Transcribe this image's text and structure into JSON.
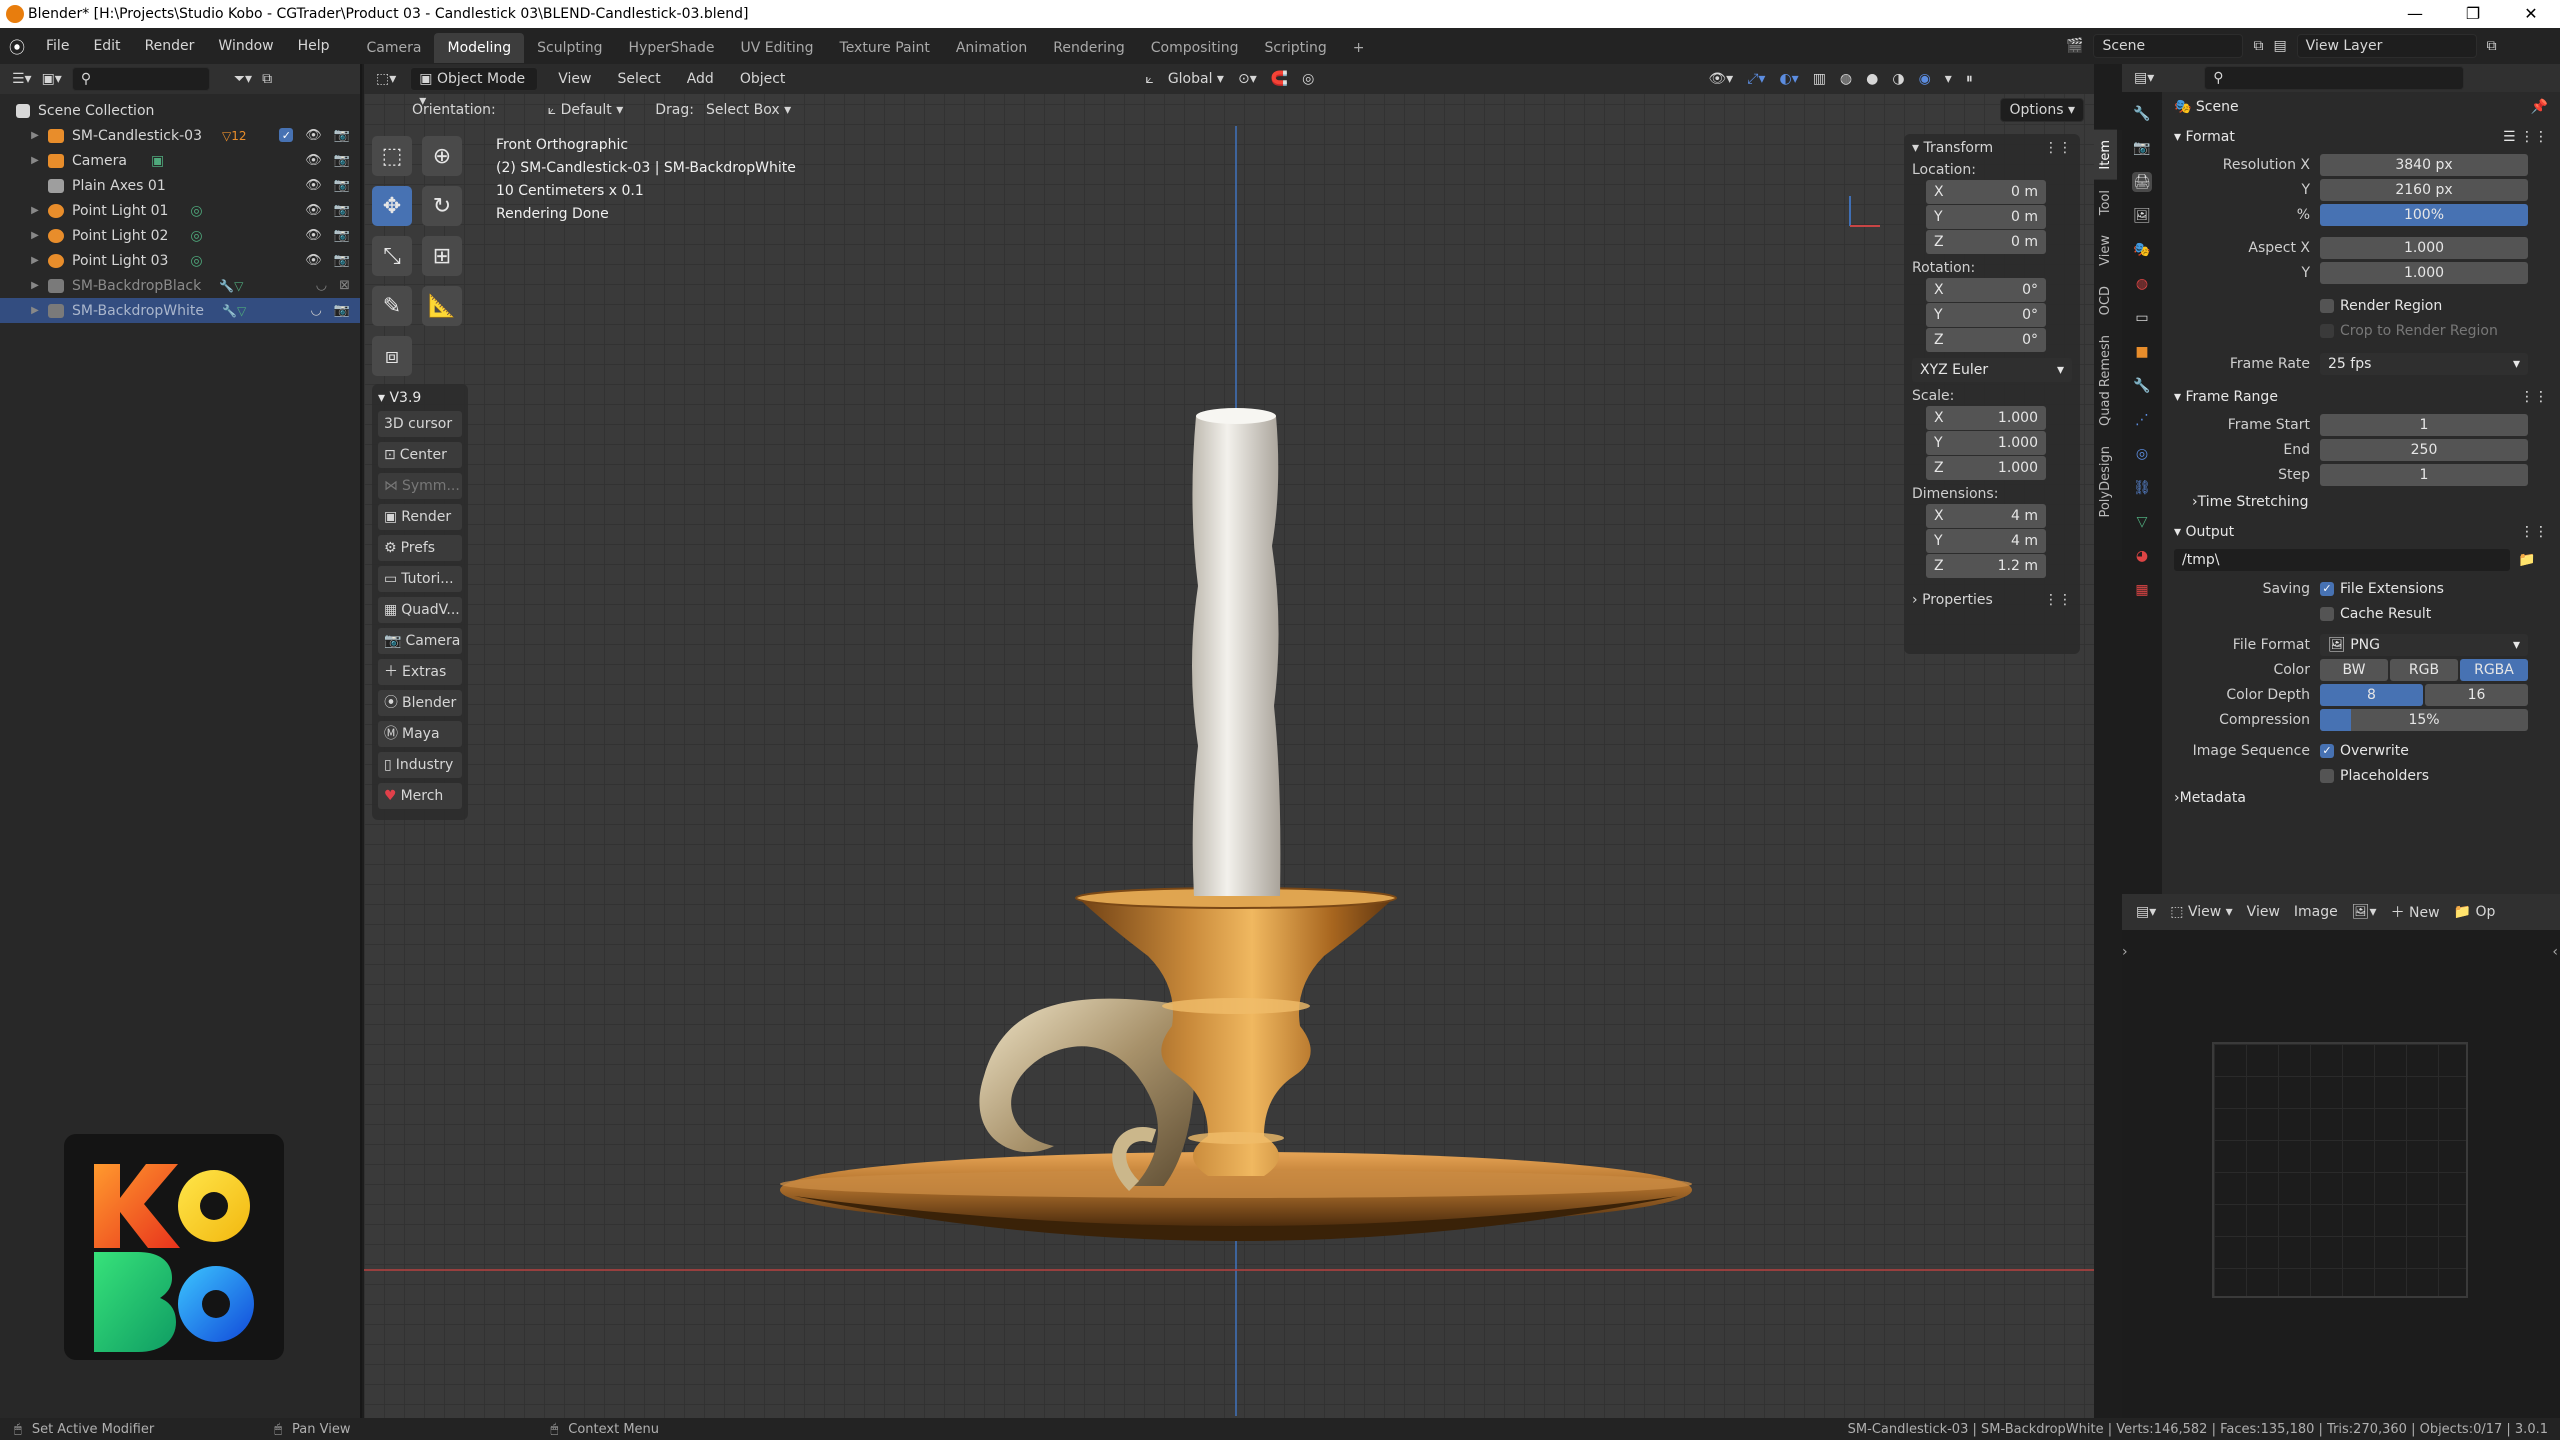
{
  "titlebar": {
    "title": "Blender* [H:\\Projects\\Studio Kobo - CGTrader\\Product 03 - Candlestick 03\\BLEND-Candlestick-03.blend]"
  },
  "menu": [
    "File",
    "Edit",
    "Render",
    "Window",
    "Help"
  ],
  "workspaces": [
    "Camera",
    "Modeling",
    "Sculpting",
    "HyperShade",
    "UV Editing",
    "Texture Paint",
    "Animation",
    "Rendering",
    "Compositing",
    "Scripting"
  ],
  "workspace_add": "+",
  "topright": {
    "scene": "Scene",
    "view_layer": "View Layer"
  },
  "outliner": {
    "root": "Scene Collection",
    "items": [
      {
        "name": "SM-Candlestick-03",
        "badge": "12",
        "color": "#e88d2b"
      },
      {
        "name": "Camera",
        "color": "#e88d2b"
      },
      {
        "name": "Plain Axes 01",
        "color": "#9e9e9e"
      },
      {
        "name": "Point Light 01",
        "color": "#e88d2b"
      },
      {
        "name": "Point Light 02",
        "color": "#e88d2b"
      },
      {
        "name": "Point Light 03",
        "color": "#e88d2b"
      },
      {
        "name": "SM-BackdropBlack",
        "color": "#7a7a7a"
      },
      {
        "name": "SM-BackdropWhite",
        "color": "#7a7a7a"
      }
    ]
  },
  "viewport": {
    "mode": "Object Mode",
    "header_menu": [
      "View",
      "Select",
      "Add",
      "Object"
    ],
    "transform_space": "Global",
    "orientation_label": "Orientation:",
    "orientation_value": "Default",
    "drag_label": "Drag:",
    "drag_value": "Select Box",
    "options": "Options",
    "info": [
      "Front Orthographic",
      "(2) SM-Candlestick-03 | SM-BackdropWhite",
      "10 Centimeters x 0.1",
      "Rendering Done"
    ]
  },
  "v39": {
    "title": "V3.9",
    "buttons": [
      "3D cursor",
      "Center",
      "Symm...",
      "Render",
      "Prefs",
      "Tutori...",
      "QuadV...",
      "Camera",
      "Extras",
      "Blender",
      "Maya",
      "Industry",
      "Merch"
    ]
  },
  "npanel": {
    "transform": "Transform",
    "location_label": "Location:",
    "location": [
      [
        "X",
        "0 m"
      ],
      [
        "Y",
        "0 m"
      ],
      [
        "Z",
        "0 m"
      ]
    ],
    "rotation_label": "Rotation:",
    "rotation": [
      [
        "X",
        "0°"
      ],
      [
        "Y",
        "0°"
      ],
      [
        "Z",
        "0°"
      ]
    ],
    "rot_mode": "XYZ Euler",
    "scale_label": "Scale:",
    "scale": [
      [
        "X",
        "1.000"
      ],
      [
        "Y",
        "1.000"
      ],
      [
        "Z",
        "1.000"
      ]
    ],
    "dimensions_label": "Dimensions:",
    "dimensions": [
      [
        "X",
        "4 m"
      ],
      [
        "Y",
        "4 m"
      ],
      [
        "Z",
        "1.2 m"
      ]
    ],
    "properties": "Properties",
    "tabs": [
      "Item",
      "Tool",
      "View",
      "OCD",
      "Quad Remesh",
      "PolyDesign"
    ]
  },
  "properties": {
    "scene": "Scene",
    "format": "Format",
    "resolution_x_label": "Resolution X",
    "resolution_x": "3840 px",
    "resolution_y_label": "Y",
    "resolution_y": "2160 px",
    "percent_label": "%",
    "percent": "100%",
    "aspect_x_label": "Aspect X",
    "aspect_x": "1.000",
    "aspect_y_label": "Y",
    "aspect_y": "1.000",
    "render_region": "Render Region",
    "crop_region": "Crop to Render Region",
    "frame_rate_label": "Frame Rate",
    "frame_rate": "25 fps",
    "frame_range": "Frame Range",
    "frame_start_label": "Frame Start",
    "frame_start": "1",
    "end_label": "End",
    "end": "250",
    "step_label": "Step",
    "step": "1",
    "time_stretching": "Time Stretching",
    "output": "Output",
    "output_path": "/tmp\\",
    "saving_label": "Saving",
    "file_extensions": "File Extensions",
    "cache_result": "Cache Result",
    "file_format_label": "File Format",
    "file_format": "PNG",
    "color_label": "Color",
    "color_options": [
      "BW",
      "RGB",
      "RGBA"
    ],
    "color_depth_label": "Color Depth",
    "color_depth": [
      "8",
      "16"
    ],
    "compression_label": "Compression",
    "compression": "15%",
    "compression_fraction": 0.15,
    "image_sequence_label": "Image Sequence",
    "overwrite": "Overwrite",
    "placeholders": "Placeholders",
    "metadata": "Metadata"
  },
  "image_editor": {
    "view": "View",
    "menu": [
      "View",
      "Image"
    ],
    "new": "New",
    "open": "Op"
  },
  "statusbar": {
    "left1": "Set Active Modifier",
    "left2": "Pan View",
    "left3": "Context Menu",
    "right": "SM-Candlestick-03 | SM-BackdropWhite | Verts:146,582 | Faces:135,180 | Tris:270,360 | Objects:0/17 | 3.0.1"
  },
  "colors": {
    "accent": "#4772b3",
    "selection": "#334d80",
    "brass": "#c8893a",
    "candle": "#e9e6df"
  }
}
